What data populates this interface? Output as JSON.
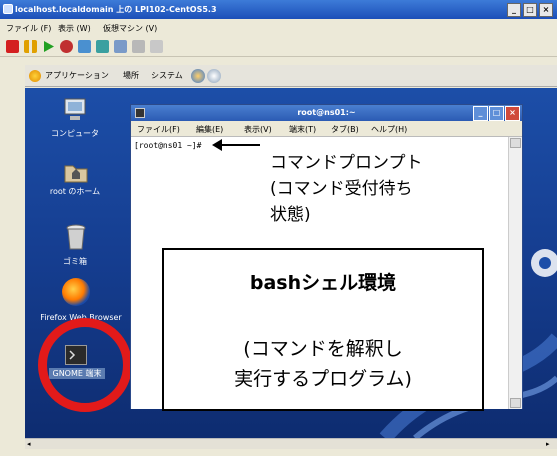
{
  "vm_window": {
    "title": "localhost.localdomain 上の LPI102-CentOS5.3",
    "menu": [
      "ファイル (F)",
      "表示 (W)",
      "仮想マシン (V)"
    ]
  },
  "gnome_panel": {
    "applications": "アプリケーション",
    "places": "場所",
    "system": "システム"
  },
  "desktop_icons": [
    {
      "label": "コンピュータ",
      "icon": "computer-icon"
    },
    {
      "label": "root のホーム",
      "icon": "home-folder-icon"
    },
    {
      "label": "ゴミ箱",
      "icon": "trash-icon"
    },
    {
      "label": "Firefox Web Browser",
      "icon": "firefox-icon"
    },
    {
      "label": "GNOME 端末",
      "icon": "terminal-icon"
    }
  ],
  "terminal": {
    "title": "root@ns01:~",
    "menu": [
      "ファイル(F)",
      "編集(E)",
      "表示(V)",
      "端末(T)",
      "タブ(B)",
      "ヘルプ(H)"
    ],
    "prompt": "[root@ns01 ~]#"
  },
  "annotations": {
    "prompt_callout_line1": "コマンドプロンプト",
    "prompt_callout_line2": "(コマンド受付待ち",
    "prompt_callout_line3": "状態)",
    "bash_title": "bashシェル環境",
    "bash_desc_line1": "(コマンドを解釈し",
    "bash_desc_line2": "実行するプログラム)"
  },
  "colors": {
    "highlight_circle": "#e21a1a",
    "desktop_blue": "#1c4ea8",
    "titlebar_blue": "#2b5bb3"
  }
}
